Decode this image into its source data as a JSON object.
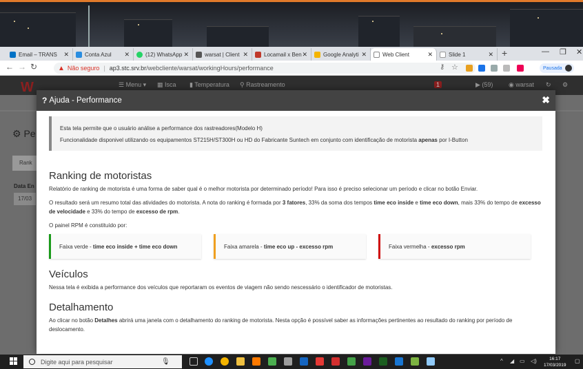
{
  "browser": {
    "tabs": [
      {
        "label": "Email – TRANS",
        "icon": "outlook-icon",
        "color": "#0072c6"
      },
      {
        "label": "Conta Azul",
        "icon": "conta-azul-icon",
        "color": "#2a8de0"
      },
      {
        "label": "(12) WhatsApp",
        "icon": "whatsapp-icon",
        "color": "#25d366"
      },
      {
        "label": "warsat | Client",
        "icon": "warsat-icon",
        "color": "#555555"
      },
      {
        "label": "Locamail x Ben",
        "icon": "locamail-icon",
        "color": "#c0392b"
      },
      {
        "label": "Google Analyti",
        "icon": "analytics-icon",
        "color": "#f4b400"
      },
      {
        "label": "Web Client",
        "icon": "web-client-icon",
        "color": "#888888"
      },
      {
        "label": "Slide 1",
        "icon": "page-icon",
        "color": "#bbbbbb"
      }
    ],
    "new_tab": "+",
    "security_label": "Não seguro",
    "domain": "ap3.stc.srv.br",
    "path": "/webcliente/warsat/workingHours/performance",
    "paused_label": "Pausada"
  },
  "app": {
    "logo": "W",
    "nav": [
      "Menu",
      "Isca",
      "Temperatura",
      "Rastreamento"
    ],
    "notif_count": "(59)",
    "user": "warsat",
    "bg_title": "Pe",
    "bg_tab": "Rank",
    "bg_date_label": "Data En",
    "bg_date_value": "17/03"
  },
  "modal": {
    "title": "Ajuda - Performance",
    "notice_line1": "Esta tela permite que o usuário análise a performance dos rastreadores(Modelo H)",
    "notice_line2_a": "Funcionalidade disponivel utilizando os equipamentos ST215H/ST300H ou HD do Fabricante Suntech em conjunto com identificação de motorista ",
    "notice_line2_b": "apenas",
    "notice_line2_c": " por I-Button",
    "ranking_heading": "Ranking de motoristas",
    "ranking_p1": "Relatório de ranking de motorista é uma forma de saber qual é o melhor motorista por determinado período! Para isso é preciso selecionar um período e clicar no botão Enviar.",
    "ranking_p2_a": "O resultado será um resumo total das atividades do motorista. A nota do ranking é formada por ",
    "ranking_p2_b": "3 fatores",
    "ranking_p2_c": ", 33% da soma dos tempos ",
    "ranking_p2_d": "time eco inside",
    "ranking_p2_e": " e ",
    "ranking_p2_f": "time eco down",
    "ranking_p2_g": ", mais 33% do tempo de ",
    "ranking_p2_h": "excesso de velocidade",
    "ranking_p2_i": " e 33% do tempo de ",
    "ranking_p2_j": "excesso de rpm",
    "ranking_p2_k": ".",
    "rpm_intro": "O painel RPM é constituído por:",
    "panels": [
      {
        "prefix": "Faixa verde - ",
        "bold": "time eco inside + time eco down",
        "color": "#1a9a1a"
      },
      {
        "prefix": "Faixa amarela - ",
        "bold": "time eco up - excesso rpm",
        "color": "#f0a020"
      },
      {
        "prefix": "Faixa vermelha - ",
        "bold": "excesso rpm",
        "color": "#d01010"
      }
    ],
    "veiculos_heading": "Veículos",
    "veiculos_p": "Nessa tela é exibida a performance dos veículos que reportaram os eventos de viagem não sendo nescessário o identificador de motoristas.",
    "detalhamento_heading": "Detalhamento",
    "detalhamento_p_a": "Ao clicar no botão ",
    "detalhamento_p_b": "Detalhes",
    "detalhamento_p_c": " abrirá uma janela com o detalhamento do ranking de motorista. Nesta opção é possível saber as informações pertinentes ao resultado do ranking por período de deslocamento."
  },
  "taskbar": {
    "search_placeholder": "Digite aqui para pesquisar",
    "time": "16:17",
    "date": "17/03/2019"
  }
}
